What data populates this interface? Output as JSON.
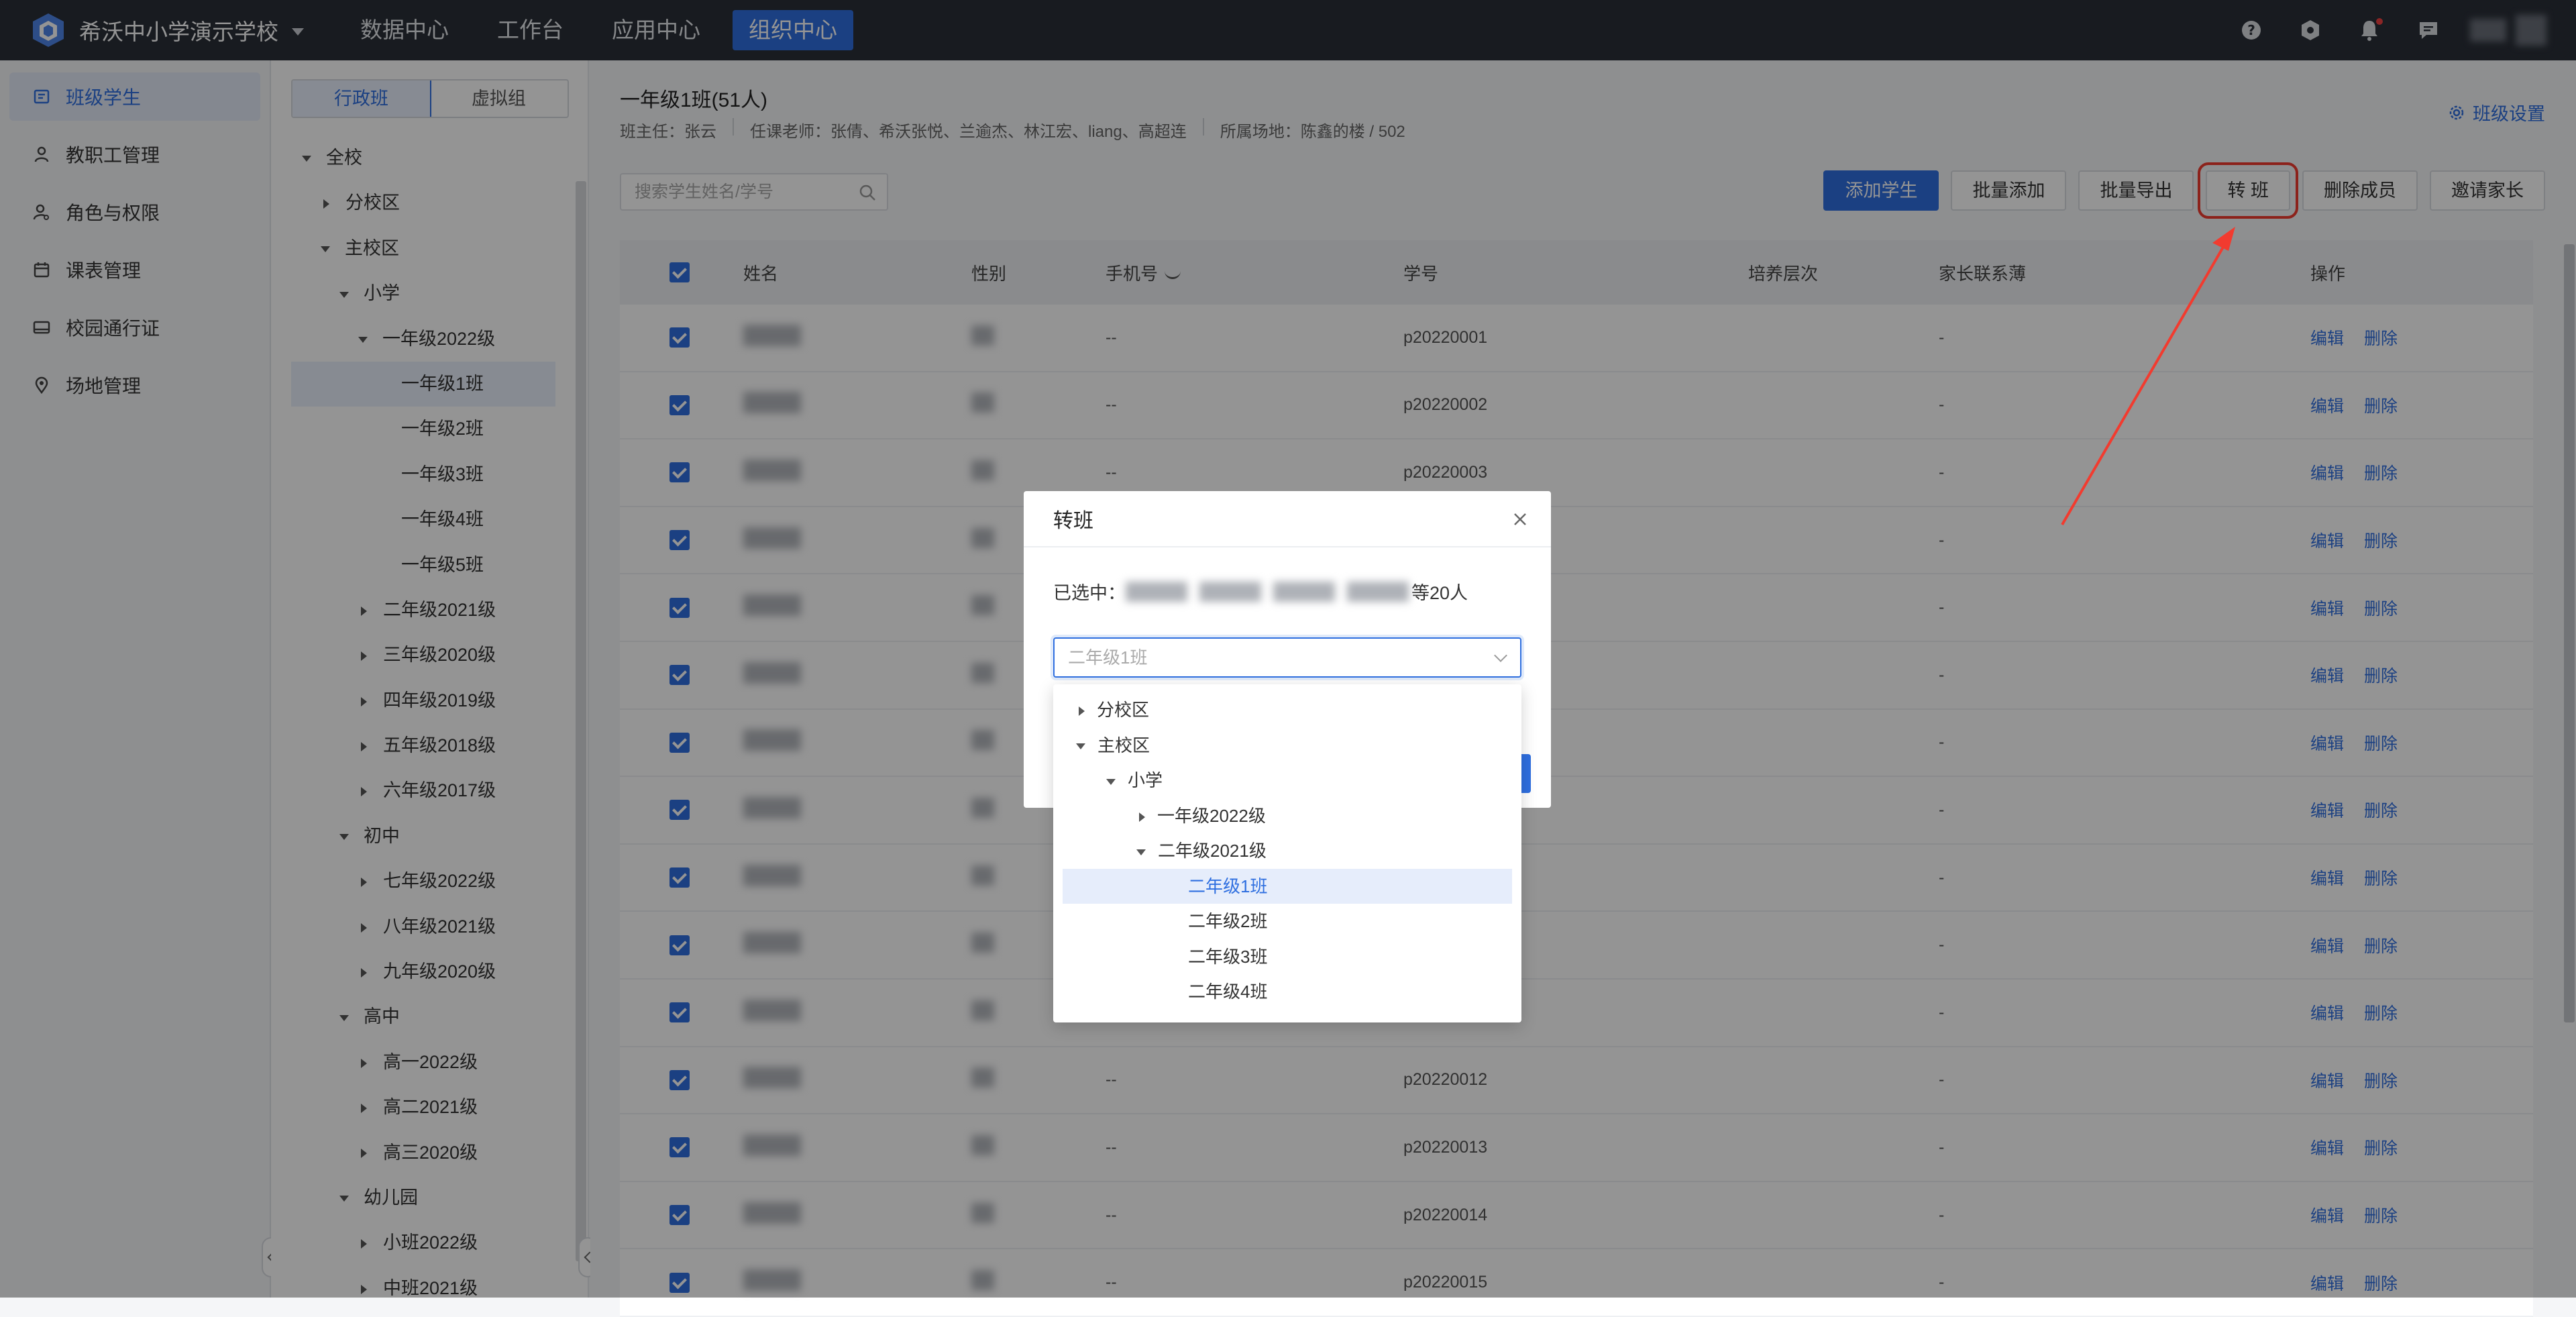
{
  "topbar": {
    "school": "希沃中小学演示学校",
    "nav": [
      "数据中心",
      "工作台",
      "应用中心",
      "组织中心"
    ],
    "active_nav": 3
  },
  "sidebar": {
    "items": [
      {
        "label": "班级学生",
        "icon": "student-icon"
      },
      {
        "label": "教职工管理",
        "icon": "person-icon"
      },
      {
        "label": "角色与权限",
        "icon": "role-icon"
      },
      {
        "label": "课表管理",
        "icon": "calendar-icon"
      },
      {
        "label": "校园通行证",
        "icon": "card-icon"
      },
      {
        "label": "场地管理",
        "icon": "location-icon"
      }
    ]
  },
  "tree_panel": {
    "tabs": [
      "行政班",
      "虚拟组"
    ],
    "nodes": [
      {
        "label": "全校",
        "level": 0,
        "state": "open"
      },
      {
        "label": "分校区",
        "level": 1,
        "state": "closed"
      },
      {
        "label": "主校区",
        "level": 1,
        "state": "open"
      },
      {
        "label": "小学",
        "level": 2,
        "state": "open"
      },
      {
        "label": "一年级2022级",
        "level": 3,
        "state": "open"
      },
      {
        "label": "一年级1班",
        "level": 4,
        "state": "leaf",
        "selected": true
      },
      {
        "label": "一年级2班",
        "level": 4,
        "state": "leaf"
      },
      {
        "label": "一年级3班",
        "level": 4,
        "state": "leaf"
      },
      {
        "label": "一年级4班",
        "level": 4,
        "state": "leaf"
      },
      {
        "label": "一年级5班",
        "level": 4,
        "state": "leaf"
      },
      {
        "label": "二年级2021级",
        "level": 3,
        "state": "closed"
      },
      {
        "label": "三年级2020级",
        "level": 3,
        "state": "closed"
      },
      {
        "label": "四年级2019级",
        "level": 3,
        "state": "closed"
      },
      {
        "label": "五年级2018级",
        "level": 3,
        "state": "closed"
      },
      {
        "label": "六年级2017级",
        "level": 3,
        "state": "closed"
      },
      {
        "label": "初中",
        "level": 2,
        "state": "open"
      },
      {
        "label": "七年级2022级",
        "level": 3,
        "state": "closed"
      },
      {
        "label": "八年级2021级",
        "level": 3,
        "state": "closed"
      },
      {
        "label": "九年级2020级",
        "level": 3,
        "state": "closed"
      },
      {
        "label": "高中",
        "level": 2,
        "state": "open"
      },
      {
        "label": "高一2022级",
        "level": 3,
        "state": "closed"
      },
      {
        "label": "高二2021级",
        "level": 3,
        "state": "closed"
      },
      {
        "label": "高三2020级",
        "level": 3,
        "state": "closed"
      },
      {
        "label": "幼儿园",
        "level": 2,
        "state": "open"
      },
      {
        "label": "小班2022级",
        "level": 3,
        "state": "closed"
      },
      {
        "label": "中班2021级",
        "level": 3,
        "state": "closed"
      }
    ]
  },
  "main": {
    "class_title": "一年级1班(51人)",
    "head_teacher": "班主任：张云",
    "teachers": "任课老师：张倩、希沃张悦、兰逾杰、林江宏、liang、高超连",
    "location": "所属场地：陈鑫的楼 / 502",
    "settings": "班级设置",
    "search_placeholder": "搜索学生姓名/学号",
    "actions": [
      "添加学生",
      "批量添加",
      "批量导出",
      "转 班",
      "删除成员",
      "邀请家长"
    ],
    "columns": [
      "姓名",
      "性别",
      "手机号",
      "学号",
      "培养层次",
      "家长联系薄",
      "操作"
    ],
    "rows": [
      {
        "phone": "--",
        "no": "p20220001",
        "parent": "-"
      },
      {
        "phone": "--",
        "no": "p20220002",
        "parent": "-"
      },
      {
        "phone": "--",
        "no": "p20220003",
        "parent": "-"
      },
      {
        "phone": "",
        "no": "",
        "parent": "-"
      },
      {
        "phone": "",
        "no": "",
        "parent": "-"
      },
      {
        "phone": "",
        "no": "",
        "parent": "-"
      },
      {
        "phone": "",
        "no": "",
        "parent": "-"
      },
      {
        "phone": "",
        "no": "",
        "parent": "-"
      },
      {
        "phone": "",
        "no": "",
        "parent": "-"
      },
      {
        "phone": "",
        "no": "",
        "parent": "-"
      },
      {
        "phone": "",
        "no": "",
        "parent": "-"
      },
      {
        "phone": "--",
        "no": "p20220012",
        "parent": "-"
      },
      {
        "phone": "--",
        "no": "p20220013",
        "parent": "-"
      },
      {
        "phone": "--",
        "no": "p20220014",
        "parent": "-"
      },
      {
        "phone": "--",
        "no": "p20220015",
        "parent": "-"
      }
    ],
    "op_edit": "编辑",
    "op_delete": "删除"
  },
  "modal": {
    "title": "转班",
    "selected_prefix": "已选中：",
    "selected_suffix": "等20人",
    "select_placeholder": "二年级1班",
    "dropdown": [
      {
        "label": "分校区",
        "level": 0,
        "state": "closed"
      },
      {
        "label": "主校区",
        "level": 0,
        "state": "open"
      },
      {
        "label": "小学",
        "level": 1,
        "state": "open"
      },
      {
        "label": "一年级2022级",
        "level": 2,
        "state": "closed"
      },
      {
        "label": "二年级2021级",
        "level": 2,
        "state": "open"
      },
      {
        "label": "二年级1班",
        "level": 3,
        "state": "leaf",
        "selected": true
      },
      {
        "label": "二年级2班",
        "level": 3,
        "state": "leaf"
      },
      {
        "label": "二年级3班",
        "level": 3,
        "state": "leaf"
      },
      {
        "label": "二年级4班",
        "level": 3,
        "state": "leaf"
      }
    ]
  },
  "colors": {
    "accent": "#2f6fe0",
    "topbar": "#2a2f38",
    "annotation": "#f23b2f"
  }
}
